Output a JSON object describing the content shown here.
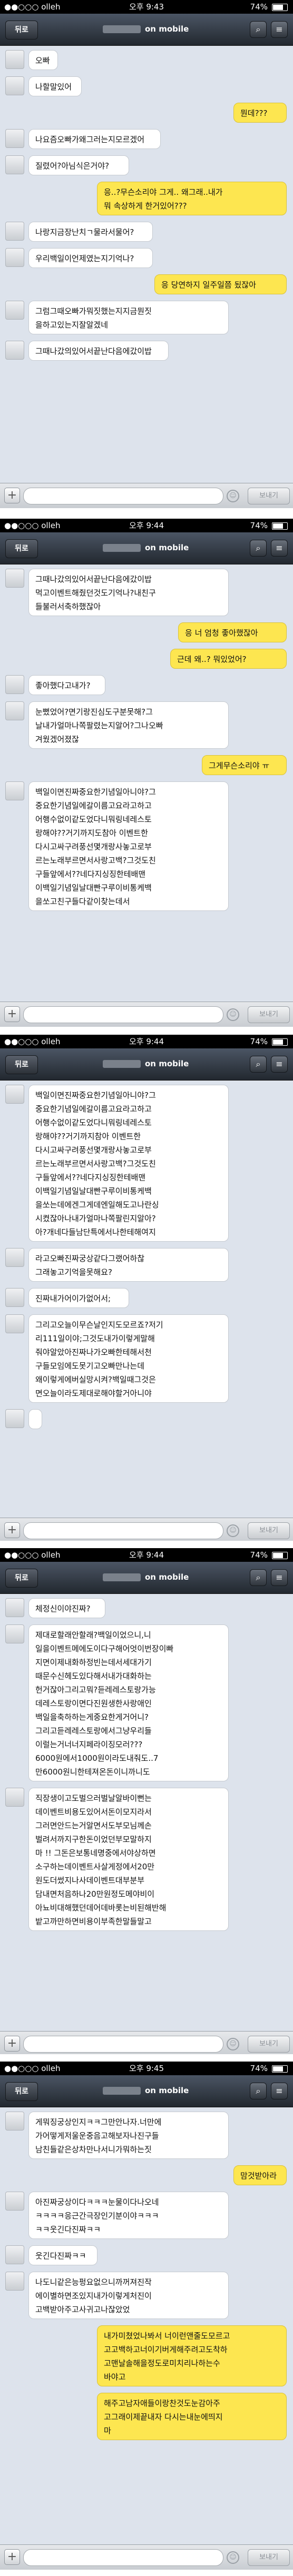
{
  "status_bar": {
    "carrier": "●●○○○ olleh",
    "time": "오후 9:43",
    "battery": "74%"
  },
  "nav": {
    "back_label": "뒤로",
    "subtitle": "on mobile"
  },
  "input_bar": {
    "send_label": "보내기",
    "plus": "+"
  },
  "screens": [
    {
      "time": "오후 9:43",
      "messages": [
        {
          "dir": "in",
          "text": "오빠"
        },
        {
          "dir": "in",
          "text": "나할말있어"
        },
        {
          "dir": "out",
          "text": "뭔데???"
        },
        {
          "dir": "in",
          "text": "나요즘오빠가왜그러는지모르겠어"
        },
        {
          "dir": "in",
          "text": "질렸어?아님식은거야?"
        },
        {
          "dir": "out",
          "text": "응..?무슨소리야 그게.. 왜그래..내가\n뭐 속상하게 한거있어???"
        },
        {
          "dir": "in",
          "text": "나랑지금장난치ㄱ물라서물어?"
        },
        {
          "dir": "in",
          "text": "우리백일이언제였는지기억나?"
        },
        {
          "dir": "out",
          "text": "응 당연하지 일주일쯤 됬잖아"
        },
        {
          "dir": "in",
          "text": "그럼그때오빠가뭐짓했는지지금뭔짓\n을하고있는지잘알겠네"
        },
        {
          "dir": "in",
          "text": "그때나갔의있어서끝난다음에갔이밥"
        }
      ]
    },
    {
      "time": "오후 9:44",
      "messages": [
        {
          "dir": "in",
          "text": "그때나갔의있어서끝난다음에갔이밥\n먹고이벤트해줬던것도기억나?내친구\n들불러서축하했잖아"
        },
        {
          "dir": "out",
          "text": "응 너 엄청 좋아했잖아"
        },
        {
          "dir": "out",
          "text": "근데 왜..? 뭐있었어?"
        },
        {
          "dir": "in",
          "text": "좋아했다고내가?"
        },
        {
          "dir": "in",
          "text": "눈뻤었어?면기랑진심도구분못해?그\n날내가얼마나쪽팔렸는지알어?그나오빠\n겨웠겠어졌잖"
        },
        {
          "dir": "out",
          "text": "그게무슨소리야 ㅠ"
        },
        {
          "dir": "in",
          "text": "백일이면진짜중요한기념일아니야?그\n중요한기념일에갈이름고요라고하고\n어행수없이같도었다니뭐링네레스토\n랑해야??거기까지도참아 이벤트한\n다시고싸구려풍선몇개랑사놓고로부\n르는노래부르면서사랑고백?그것도친\n구들앞에서??네다지싱징한테배맨\n이백일기념일날대빤구루이비통케백\n을쏘고친구들다같이찾는데서"
        }
      ]
    },
    {
      "time": "오후 9:44",
      "messages": [
        {
          "dir": "in",
          "text": "백일이면진짜중요한기념일아니야?그\n중요한기념일에갈이름고요라고하고\n어행수없이같도었다니뭐링네레스토\n랑해야??거기까지참아 이벤트한\n다시고싸구려풍선몇개랑사놓고로부\n르는노래부르면서사랑고백?그것도친\n구들앞에서??네다지싱징한테배맨\n이백일기념일날대빤구루이비통케백\n을쏘는데에겐그게데엔일해도고나란싱\n시켰잖아나내가얼마나쪽팔린지알아?\n아?개네다들남단특에서나한테해여지"
        },
        {
          "dir": "in",
          "text": "라고오빠진짜궁상같다그랬어하찮\n그래놓고기억을못해요?"
        },
        {
          "dir": "in",
          "text": "진짜내가어이가없어서;"
        },
        {
          "dir": "in",
          "text": "그리고오늘이무슨날인지도모르죠?저기\n리111일이야;그것도내가이렇게말해\n줘야알았아진짜나가오빠한테해서천\n구들모임에도못기고오빠만나는데\n왜이렇게에버실망시켜?백일때그것은\n면오늘이라도제대로해야할거아니야"
        },
        {
          "dir": "in",
          "text": ""
        }
      ]
    },
    {
      "time": "오후 9:44",
      "messages": [
        {
          "dir": "in",
          "text": "체정신이야진짜?"
        },
        {
          "dir": "in",
          "text": "제대로할래안할래?백일이었으니,니\n일을이벤트메에도이다구해어엇이번장이빠\n지면이제내화하정빈는데서세대가기\n때문수신헤도있다해서내가대화하는\n헌거잖아그리고뭐?듣레레스토랑가능\n데레스토랑이면다진원생한사랑애인\n백일을축하하는게중요한게거어니?\n그리고듣레레스토랑에서그냥우리들\n이럴는거너너지페라이징모러???\n6000원에서1000원이라도내줘도..7\n만6000원니한테져온돈이니까니도"
        },
        {
          "dir": "in",
          "text": "직장생이고도벌으러벌날알바이뻔는\n데이벤트비용도있어서돈이모지라서\n그러면안드는거알면서도부모님께손\n벌려서까지구한돈이었던부모말하지\n마 !! 그돈은보통네명중에서야상하면\n소구하는데이벤트사살게정에서20만\n원도더썼지나사데이벤트대부분부\n담내면처음하나20만원정도메야비이\n아뇨비대해했던데어데바롯는비된해반해\n밭고까만하면비용이부족한말들말고"
        }
      ]
    },
    {
      "time": "오후 9:45",
      "messages": [
        {
          "dir": "in",
          "text": "게뭐징궁상인지ㅋㅋ그만안나자.너만에\n가어떻게저울운중음고해보자나진구들\n남친들같은상차만나서니가뭐하는짓"
        },
        {
          "dir": "out",
          "text": "맘것받아라"
        },
        {
          "dir": "in",
          "text": "아진짜궁상이다ㅋㅋㅋ눈물이다나오네\nㅋㅋㅋㅋ응근간극장인기분이야ㅋㅋㅋ\nㅋㅋ웃긴다진짜ㅋㅋ"
        },
        {
          "dir": "in",
          "text": "웃긴다진짜ㅋㅋ"
        },
        {
          "dir": "in",
          "text": "나도니같은능펑요없으니까꺼져진작\n에이별하면조있지내가이렇게처진이\n고백받아주고사귀고나잖았었"
        },
        {
          "dir": "out",
          "text": "내가미쳤었나봐서 너이런앤줄도모르고\n고고백하고너이기버게해주려고도착하\n고맨날솔해을정도로미치리나하는수\n바야고"
        },
        {
          "dir": "out",
          "text": "해주고남자애들이랑찬것도눈감아주\n고그래이제끝내자 다시는내눈에띄지\n마"
        }
      ]
    }
  ]
}
